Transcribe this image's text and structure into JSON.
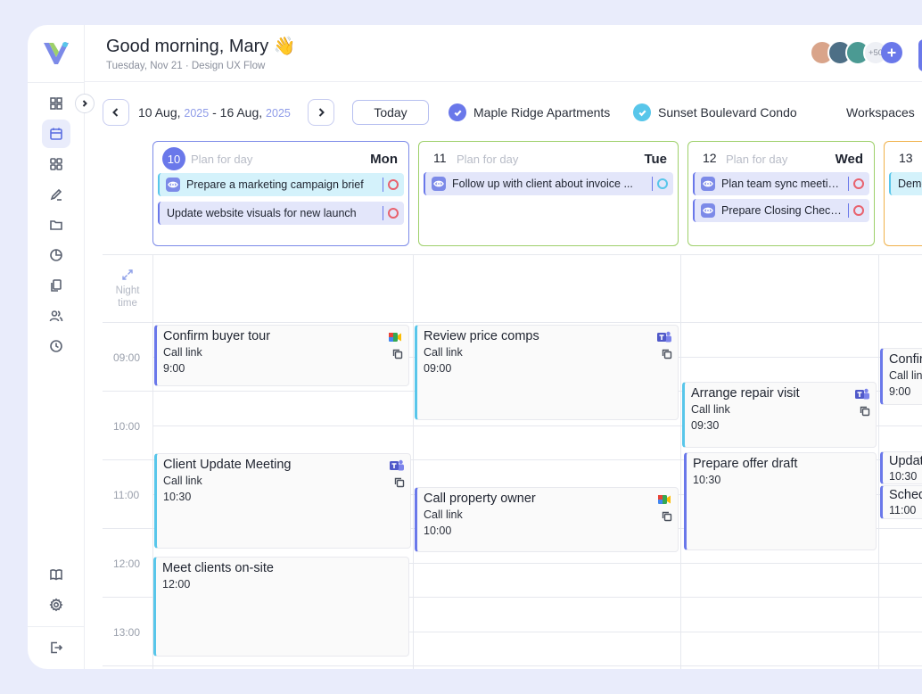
{
  "header": {
    "greeting": "Good morning, Mary 👋",
    "subline": "Tuesday, Nov 21 · Design UX Flow",
    "avatar_count": "+50"
  },
  "toolbar": {
    "range_start": "10 Aug,",
    "range_start_year": "2025",
    "range_sep": "-",
    "range_end": "16 Aug,",
    "range_end_year": "2025",
    "today": "Today",
    "filters": [
      {
        "label": "Maple Ridge Apartments",
        "color": "#6a78ea"
      },
      {
        "label": "Sunset Boulevard Condo",
        "color": "#58c6ea"
      }
    ],
    "workspaces": "Workspaces"
  },
  "days": [
    {
      "num": "10",
      "plan": "Plan for day",
      "weekday": "Mon",
      "border": "#7c8ae8",
      "tasks": [
        {
          "label": "Prepare a marketing campaign brief",
          "style": "cyan",
          "eye": true,
          "rec": "#e8626e"
        },
        {
          "label": "Update website visuals for new launch",
          "style": "lav",
          "eye": false,
          "rec": "#e8626e"
        }
      ]
    },
    {
      "num": "11",
      "plan": "Plan for day",
      "weekday": "Tue",
      "border": "#9ed06a",
      "tasks": [
        {
          "label": "Follow up with client about invoice ...",
          "style": "lav",
          "eye": true,
          "rec": "#58c6ea"
        }
      ]
    },
    {
      "num": "12",
      "plan": "Plan for day",
      "weekday": "Wed",
      "border": "#9ed06a",
      "tasks": [
        {
          "label": "Plan team sync meeting...",
          "style": "lav",
          "eye": true,
          "rec": "#e8626e"
        },
        {
          "label": "Prepare Closing Checklist",
          "style": "lav",
          "eye": true,
          "rec": "#e8626e"
        }
      ]
    },
    {
      "num": "13",
      "plan": "",
      "weekday": "",
      "border": "#f0b14a",
      "tasks": [
        {
          "label": "Demo",
          "style": "cyan",
          "eye": false,
          "rec": ""
        }
      ]
    }
  ],
  "grid": {
    "night_label": "Night time",
    "times": [
      "09:00",
      "10:00",
      "11:00",
      "12:00",
      "13:00"
    ]
  },
  "events": {
    "e1": {
      "title": "Confirm buyer tour",
      "sub": "Call link",
      "time": "9:00",
      "app": "meet"
    },
    "e2": {
      "title": "Client Update Meeting",
      "sub": "Call link",
      "time": "10:30",
      "app": "teams"
    },
    "e3": {
      "title": "Meet clients on-site",
      "time": "12:00"
    },
    "e4": {
      "title": "Review price comps",
      "sub": "Call link",
      "time": "09:00",
      "app": "teams"
    },
    "e5": {
      "title": "Call property owner",
      "sub": "Call link",
      "time": "10:00",
      "app": "meet"
    },
    "e6": {
      "title": "Arrange repair visit",
      "sub": "Call link",
      "time": "09:30",
      "app": "teams"
    },
    "e7": {
      "title": "Prepare offer draft",
      "time": "10:30"
    },
    "e8": {
      "title": "Confirm",
      "sub": "Call lin",
      "time": "9:00"
    },
    "e9": {
      "title": "Updat",
      "time": "10:30"
    },
    "e10": {
      "title": "Sched",
      "time": "11:00"
    }
  }
}
